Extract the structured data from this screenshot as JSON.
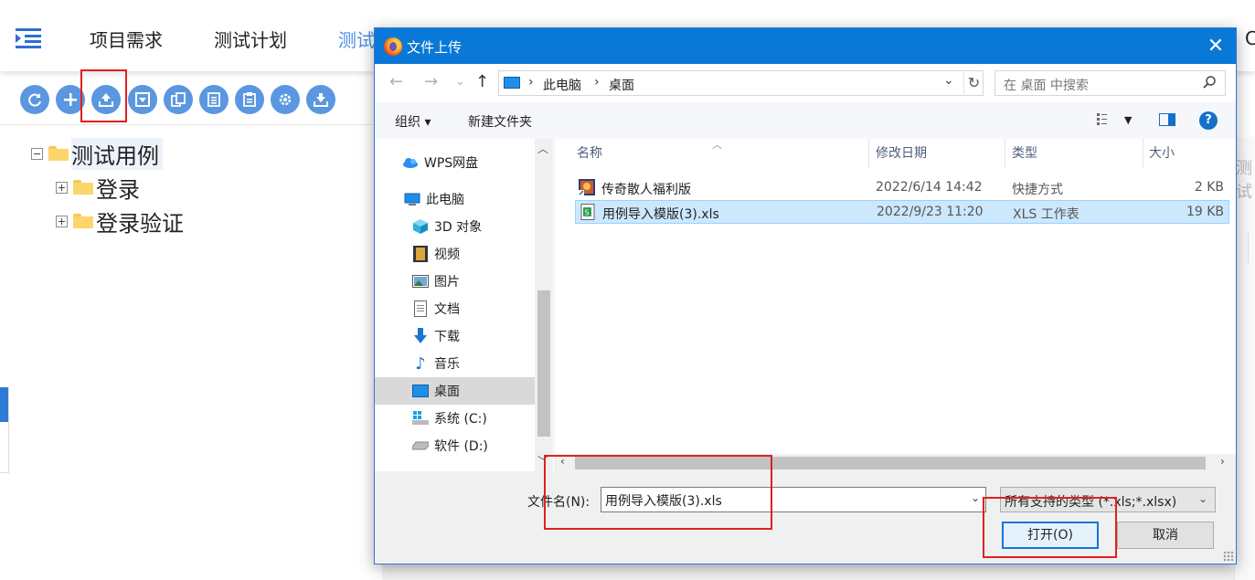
{
  "app": {
    "nav": [
      "项目需求",
      "测试计划",
      "测试"
    ],
    "right_partial": "C"
  },
  "toolbar": {
    "buttons": [
      "refresh-icon",
      "add-icon",
      "upload-icon",
      "import-icon",
      "copy-icon",
      "list-icon",
      "clipboard-icon",
      "settings-icon",
      "download-icon"
    ]
  },
  "tree": {
    "root": "测试用例",
    "children": [
      "登录",
      "登录验证"
    ]
  },
  "right_stub_text": "测试",
  "dialog": {
    "title": "文件上传",
    "close": "✕",
    "address": {
      "crumbs": [
        "此电脑",
        "桌面"
      ]
    },
    "search_placeholder": "在 桌面 中搜索",
    "commands": {
      "organize": "组织 ▾",
      "new_folder": "新建文件夹",
      "help": "?"
    },
    "nav_pane": [
      {
        "label": "WPS网盘",
        "icon": "cloud-icon"
      },
      {
        "label": "此电脑",
        "icon": "computer-icon"
      },
      {
        "label": "3D 对象",
        "icon": "cube-icon"
      },
      {
        "label": "视频",
        "icon": "video-icon"
      },
      {
        "label": "图片",
        "icon": "picture-icon"
      },
      {
        "label": "文档",
        "icon": "document-icon"
      },
      {
        "label": "下载",
        "icon": "download-arrow-icon"
      },
      {
        "label": "音乐",
        "icon": "music-icon"
      },
      {
        "label": "桌面",
        "icon": "desktop-icon",
        "selected": true
      },
      {
        "label": "系统 (C:)",
        "icon": "windows-drive-icon"
      },
      {
        "label": "软件 (D:)",
        "icon": "drive-icon"
      }
    ],
    "columns": [
      "名称",
      "修改日期",
      "类型",
      "大小"
    ],
    "files": [
      {
        "name": "传奇散人福利版",
        "date": "2022/6/14 14:42",
        "type": "快捷方式",
        "size": "2 KB",
        "icon": "game-shortcut-icon"
      },
      {
        "name": "用例导入模版(3).xls",
        "date": "2022/9/23 11:20",
        "type": "XLS 工作表",
        "size": "19 KB",
        "icon": "xls-file-icon",
        "selected": true
      }
    ],
    "filename_label": "文件名(N):",
    "filename_value": "用例导入模版(3).xls",
    "filetype_value": "所有支持的类型 (*.xls;*.xlsx)",
    "open_button": "打开(O)",
    "cancel_button": "取消"
  },
  "colors": {
    "title_bar": "#0a78d7",
    "toolbar_button": "#5b97e0",
    "annotation": "#e02020",
    "selection": "#cce8ff"
  }
}
